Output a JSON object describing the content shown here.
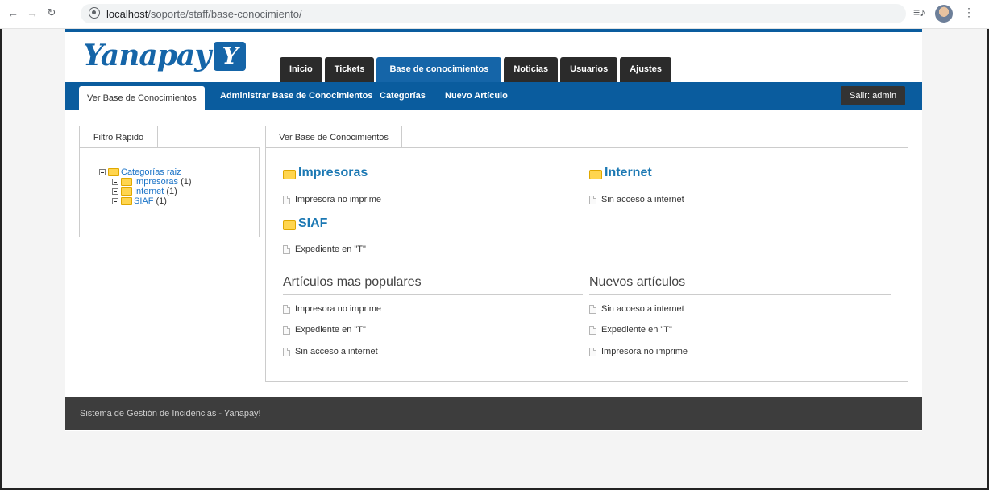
{
  "browser": {
    "url_host": "localhost",
    "url_path": "/soporte/staff/base-conocimiento/"
  },
  "logo": {
    "text": "Yanapay",
    "mark": "Y"
  },
  "main_tabs": [
    {
      "label": "Inicio"
    },
    {
      "label": "Tickets"
    },
    {
      "label": "Base de conocimientos"
    },
    {
      "label": "Noticias"
    },
    {
      "label": "Usuarios"
    },
    {
      "label": "Ajustes"
    }
  ],
  "sub_nav": {
    "items": [
      {
        "label": "Ver Base de Conocimientos"
      },
      {
        "label": "Administrar Base de Conocimientos"
      },
      {
        "label": "Categorías"
      },
      {
        "label": "Nuevo Artículo"
      }
    ],
    "logout": "Salir: admin"
  },
  "filter": {
    "tab_label": "Filtro Rápido",
    "root": "Categorías raiz",
    "children": [
      {
        "name": "Impresoras",
        "count": "(1)"
      },
      {
        "name": "Internet",
        "count": "(1)"
      },
      {
        "name": "SIAF",
        "count": "(1)"
      }
    ]
  },
  "content": {
    "tab_label": "Ver Base de Conocimientos",
    "categories": [
      {
        "title": "Impresoras",
        "article": "Impresora no imprime"
      },
      {
        "title": "Internet",
        "article": "Sin acceso a internet"
      },
      {
        "title": "SIAF",
        "article": "Expediente en \"T\""
      }
    ],
    "popular": {
      "title": "Artículos mas populares",
      "items": [
        "Impresora no imprime",
        "Expediente en \"T\"",
        "Sin acceso a internet"
      ]
    },
    "newest": {
      "title": "Nuevos artículos",
      "items": [
        "Sin acceso a internet",
        "Expediente en \"T\"",
        "Impresora no imprime"
      ]
    }
  },
  "footer": "Sistema de Gestión de Incidencias - Yanapay!",
  "colors": {
    "brand_blue": "#0a5c9e",
    "tab_dark": "#2b2b2b",
    "category_title": "#1b78b3",
    "footer_bg": "#3d3d3d"
  }
}
